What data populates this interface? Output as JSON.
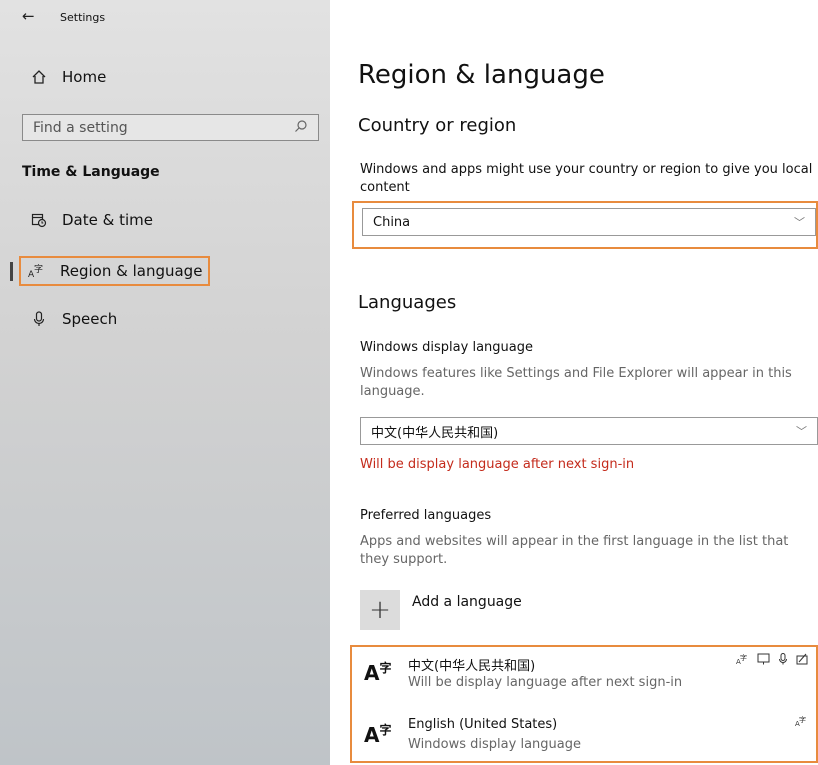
{
  "window": {
    "title": "Settings",
    "back_icon": "back-arrow-icon"
  },
  "sidebar": {
    "home_label": "Home",
    "search_placeholder": "Find a setting",
    "section_title": "Time & Language",
    "items": [
      {
        "label": "Date & time",
        "icon": "calendar-clock-icon"
      },
      {
        "label": "Region & language",
        "icon": "language-icon",
        "selected": true
      },
      {
        "label": "Speech",
        "icon": "microphone-icon"
      }
    ]
  },
  "main": {
    "title": "Region & language",
    "country": {
      "heading": "Country or region",
      "description": "Windows and apps might use your country or region to give you local content",
      "selected": "China"
    },
    "languages": {
      "heading": "Languages",
      "display_label": "Windows display language",
      "display_description": "Windows features like Settings and File Explorer will appear in this language.",
      "display_selected": "中文(中华人民共和国)",
      "display_note": "Will be display language after next sign-in",
      "preferred_label": "Preferred languages",
      "preferred_description": "Apps and websites will appear in the first language in the list that they support.",
      "add_language_label": "Add a language",
      "list": [
        {
          "name": "中文(中华人民共和国)",
          "subtitle": "Will be display language after next sign-in"
        },
        {
          "name": "English (United States)",
          "subtitle": "Windows display language"
        }
      ]
    }
  },
  "colors": {
    "highlight": "#e88b3e",
    "note_red": "#c42b1c"
  }
}
